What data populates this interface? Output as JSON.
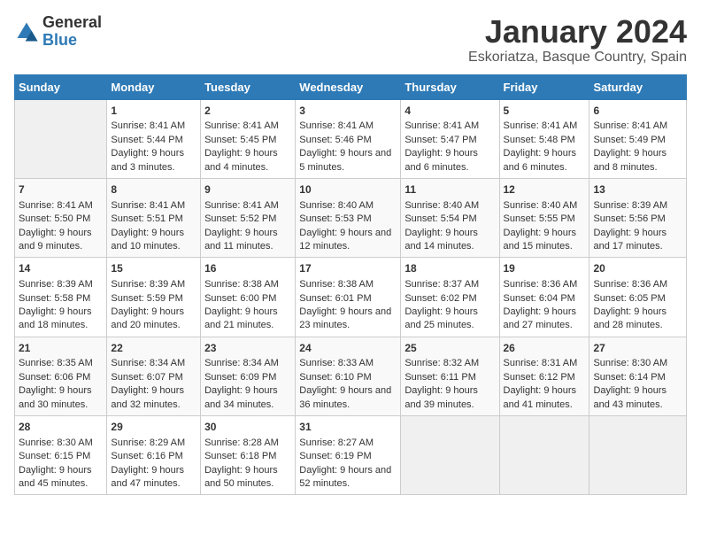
{
  "logo": {
    "general": "General",
    "blue": "Blue"
  },
  "title": "January 2024",
  "subtitle": "Eskoriatza, Basque Country, Spain",
  "weekdays": [
    "Sunday",
    "Monday",
    "Tuesday",
    "Wednesday",
    "Thursday",
    "Friday",
    "Saturday"
  ],
  "weeks": [
    [
      {
        "day": "",
        "sunrise": "",
        "sunset": "",
        "daylight": ""
      },
      {
        "day": "1",
        "sunrise": "Sunrise: 8:41 AM",
        "sunset": "Sunset: 5:44 PM",
        "daylight": "Daylight: 9 hours and 3 minutes."
      },
      {
        "day": "2",
        "sunrise": "Sunrise: 8:41 AM",
        "sunset": "Sunset: 5:45 PM",
        "daylight": "Daylight: 9 hours and 4 minutes."
      },
      {
        "day": "3",
        "sunrise": "Sunrise: 8:41 AM",
        "sunset": "Sunset: 5:46 PM",
        "daylight": "Daylight: 9 hours and 5 minutes."
      },
      {
        "day": "4",
        "sunrise": "Sunrise: 8:41 AM",
        "sunset": "Sunset: 5:47 PM",
        "daylight": "Daylight: 9 hours and 6 minutes."
      },
      {
        "day": "5",
        "sunrise": "Sunrise: 8:41 AM",
        "sunset": "Sunset: 5:48 PM",
        "daylight": "Daylight: 9 hours and 6 minutes."
      },
      {
        "day": "6",
        "sunrise": "Sunrise: 8:41 AM",
        "sunset": "Sunset: 5:49 PM",
        "daylight": "Daylight: 9 hours and 8 minutes."
      }
    ],
    [
      {
        "day": "7",
        "sunrise": "Sunrise: 8:41 AM",
        "sunset": "Sunset: 5:50 PM",
        "daylight": "Daylight: 9 hours and 9 minutes."
      },
      {
        "day": "8",
        "sunrise": "Sunrise: 8:41 AM",
        "sunset": "Sunset: 5:51 PM",
        "daylight": "Daylight: 9 hours and 10 minutes."
      },
      {
        "day": "9",
        "sunrise": "Sunrise: 8:41 AM",
        "sunset": "Sunset: 5:52 PM",
        "daylight": "Daylight: 9 hours and 11 minutes."
      },
      {
        "day": "10",
        "sunrise": "Sunrise: 8:40 AM",
        "sunset": "Sunset: 5:53 PM",
        "daylight": "Daylight: 9 hours and 12 minutes."
      },
      {
        "day": "11",
        "sunrise": "Sunrise: 8:40 AM",
        "sunset": "Sunset: 5:54 PM",
        "daylight": "Daylight: 9 hours and 14 minutes."
      },
      {
        "day": "12",
        "sunrise": "Sunrise: 8:40 AM",
        "sunset": "Sunset: 5:55 PM",
        "daylight": "Daylight: 9 hours and 15 minutes."
      },
      {
        "day": "13",
        "sunrise": "Sunrise: 8:39 AM",
        "sunset": "Sunset: 5:56 PM",
        "daylight": "Daylight: 9 hours and 17 minutes."
      }
    ],
    [
      {
        "day": "14",
        "sunrise": "Sunrise: 8:39 AM",
        "sunset": "Sunset: 5:58 PM",
        "daylight": "Daylight: 9 hours and 18 minutes."
      },
      {
        "day": "15",
        "sunrise": "Sunrise: 8:39 AM",
        "sunset": "Sunset: 5:59 PM",
        "daylight": "Daylight: 9 hours and 20 minutes."
      },
      {
        "day": "16",
        "sunrise": "Sunrise: 8:38 AM",
        "sunset": "Sunset: 6:00 PM",
        "daylight": "Daylight: 9 hours and 21 minutes."
      },
      {
        "day": "17",
        "sunrise": "Sunrise: 8:38 AM",
        "sunset": "Sunset: 6:01 PM",
        "daylight": "Daylight: 9 hours and 23 minutes."
      },
      {
        "day": "18",
        "sunrise": "Sunrise: 8:37 AM",
        "sunset": "Sunset: 6:02 PM",
        "daylight": "Daylight: 9 hours and 25 minutes."
      },
      {
        "day": "19",
        "sunrise": "Sunrise: 8:36 AM",
        "sunset": "Sunset: 6:04 PM",
        "daylight": "Daylight: 9 hours and 27 minutes."
      },
      {
        "day": "20",
        "sunrise": "Sunrise: 8:36 AM",
        "sunset": "Sunset: 6:05 PM",
        "daylight": "Daylight: 9 hours and 28 minutes."
      }
    ],
    [
      {
        "day": "21",
        "sunrise": "Sunrise: 8:35 AM",
        "sunset": "Sunset: 6:06 PM",
        "daylight": "Daylight: 9 hours and 30 minutes."
      },
      {
        "day": "22",
        "sunrise": "Sunrise: 8:34 AM",
        "sunset": "Sunset: 6:07 PM",
        "daylight": "Daylight: 9 hours and 32 minutes."
      },
      {
        "day": "23",
        "sunrise": "Sunrise: 8:34 AM",
        "sunset": "Sunset: 6:09 PM",
        "daylight": "Daylight: 9 hours and 34 minutes."
      },
      {
        "day": "24",
        "sunrise": "Sunrise: 8:33 AM",
        "sunset": "Sunset: 6:10 PM",
        "daylight": "Daylight: 9 hours and 36 minutes."
      },
      {
        "day": "25",
        "sunrise": "Sunrise: 8:32 AM",
        "sunset": "Sunset: 6:11 PM",
        "daylight": "Daylight: 9 hours and 39 minutes."
      },
      {
        "day": "26",
        "sunrise": "Sunrise: 8:31 AM",
        "sunset": "Sunset: 6:12 PM",
        "daylight": "Daylight: 9 hours and 41 minutes."
      },
      {
        "day": "27",
        "sunrise": "Sunrise: 8:30 AM",
        "sunset": "Sunset: 6:14 PM",
        "daylight": "Daylight: 9 hours and 43 minutes."
      }
    ],
    [
      {
        "day": "28",
        "sunrise": "Sunrise: 8:30 AM",
        "sunset": "Sunset: 6:15 PM",
        "daylight": "Daylight: 9 hours and 45 minutes."
      },
      {
        "day": "29",
        "sunrise": "Sunrise: 8:29 AM",
        "sunset": "Sunset: 6:16 PM",
        "daylight": "Daylight: 9 hours and 47 minutes."
      },
      {
        "day": "30",
        "sunrise": "Sunrise: 8:28 AM",
        "sunset": "Sunset: 6:18 PM",
        "daylight": "Daylight: 9 hours and 50 minutes."
      },
      {
        "day": "31",
        "sunrise": "Sunrise: 8:27 AM",
        "sunset": "Sunset: 6:19 PM",
        "daylight": "Daylight: 9 hours and 52 minutes."
      },
      {
        "day": "",
        "sunrise": "",
        "sunset": "",
        "daylight": ""
      },
      {
        "day": "",
        "sunrise": "",
        "sunset": "",
        "daylight": ""
      },
      {
        "day": "",
        "sunrise": "",
        "sunset": "",
        "daylight": ""
      }
    ]
  ]
}
